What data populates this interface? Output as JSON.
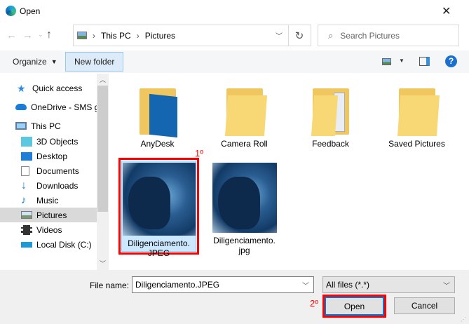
{
  "window": {
    "title": "Open",
    "close": "✕"
  },
  "address": {
    "segments": [
      "This PC",
      "Pictures"
    ],
    "separator": "›",
    "search_placeholder": "Search Pictures"
  },
  "toolbar": {
    "organize": "Organize",
    "new_folder": "New folder"
  },
  "nav": {
    "items": [
      {
        "label": "Quick access",
        "icon": "star-icon"
      },
      {
        "label": "OneDrive - SMS g",
        "icon": "cloud-icon"
      },
      {
        "label": "This PC",
        "icon": "computer-icon"
      },
      {
        "label": "3D Objects",
        "icon": "cube-icon"
      },
      {
        "label": "Desktop",
        "icon": "desktop-icon"
      },
      {
        "label": "Documents",
        "icon": "document-icon"
      },
      {
        "label": "Downloads",
        "icon": "download-icon"
      },
      {
        "label": "Music",
        "icon": "music-icon"
      },
      {
        "label": "Pictures",
        "icon": "pictures-icon",
        "selected": true
      },
      {
        "label": "Videos",
        "icon": "video-icon"
      },
      {
        "label": "Local Disk (C:)",
        "icon": "disk-icon"
      }
    ]
  },
  "files": [
    {
      "name": "AnyDesk",
      "type": "folder"
    },
    {
      "name": "Camera Roll",
      "type": "folder"
    },
    {
      "name": "Feedback",
      "type": "folder"
    },
    {
      "name": "Saved Pictures",
      "type": "folder"
    },
    {
      "name": "Diligenciamento.JPEG",
      "line1": "Diligenciamento.",
      "line2": "JPEG",
      "type": "image",
      "selected": true
    },
    {
      "name": "Diligenciamento.jpg",
      "line1": "Diligenciamento.",
      "line2": "jpg",
      "type": "image"
    }
  ],
  "annotations": {
    "first": "1º",
    "second": "2º"
  },
  "bottom": {
    "file_name_label": "File name:",
    "file_name_value": "Diligenciamento.JPEG",
    "filter": "All files (*.*)",
    "open": "Open",
    "cancel": "Cancel"
  },
  "colors": {
    "selection": "#cce8ff",
    "highlight_red": "#ff0000",
    "accent": "#0078d7"
  }
}
